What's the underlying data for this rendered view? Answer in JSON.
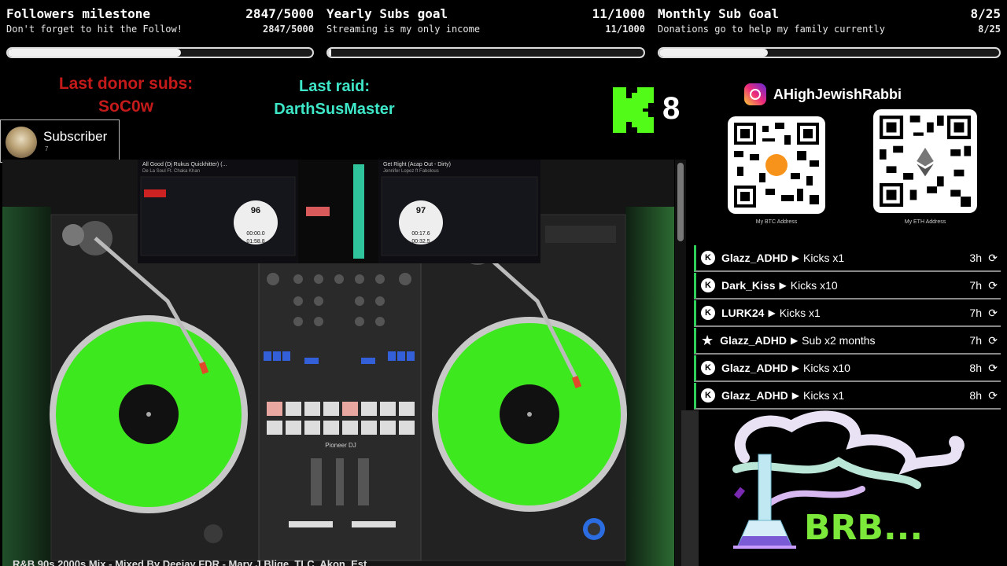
{
  "goals": [
    {
      "title": "Followers milestone",
      "count": "2847/5000",
      "subtitle": "Don't forget to hit the Follow!",
      "count2": "2847/5000",
      "progress": 0.569
    },
    {
      "title": "Yearly Subs goal",
      "count": "11/1000",
      "subtitle": "Streaming is my only income",
      "count2": "11/1000",
      "progress": 0.011
    },
    {
      "title": "Monthly Sub Goal",
      "count": "8/25",
      "subtitle": "Donations go to help my family currently",
      "count2": "8/25",
      "progress": 0.32
    }
  ],
  "donor": {
    "label": "Last donor subs:",
    "name": "SoC0w"
  },
  "raid": {
    "label": "Last raid:",
    "name": "DarthSusMaster"
  },
  "kick": {
    "count": "8",
    "logo_color": "#53fc18"
  },
  "subscriber": {
    "label": "Subscriber",
    "count": "7"
  },
  "instagram": {
    "handle": "AHighJewishRabbi",
    "icon": "instagram-icon"
  },
  "qr": {
    "btc_label": "My BTC Address",
    "eth_label": "My ETH Address"
  },
  "feed": [
    {
      "icon": "kick-icon",
      "user": "Glazz_ADHD",
      "action": "Kicks x1",
      "time": "3h"
    },
    {
      "icon": "kick-icon",
      "user": "Dark_Kiss",
      "action": "Kicks x10",
      "time": "7h"
    },
    {
      "icon": "kick-icon",
      "user": "LURK24",
      "action": "Kicks x1",
      "time": "7h"
    },
    {
      "icon": "star-icon",
      "user": "Glazz_ADHD",
      "action": "Sub x2 months",
      "time": "7h"
    },
    {
      "icon": "kick-icon",
      "user": "Glazz_ADHD",
      "action": "Kicks x10",
      "time": "8h"
    },
    {
      "icon": "kick-icon",
      "user": "Glazz_ADHD",
      "action": "Kicks x1",
      "time": "8h"
    }
  ],
  "video": {
    "caption": "R&B 90s 2000s Mix - Mixed By Deejay FDR - Mary J Blige, TLC, Akon, Est",
    "deck_left": {
      "track": "All Good (Dj Rukus Quickhitter) (...",
      "artist": "De La Soul Ft. Chaka Khan",
      "bpm": "96",
      "elapsed": "00:00.0",
      "remain": "01:58.8"
    },
    "deck_right": {
      "track": "Get Right (Acap Out - Dirty)",
      "artist": "Jennifer Lopez ft Fabolous",
      "bpm": "97",
      "elapsed": "00:17.6",
      "remain": "00:32.5"
    },
    "brand": "Pioneer DJ",
    "platter_color": "#3ee81f"
  },
  "brb": {
    "text": "BRB...",
    "color": "#7be83a"
  }
}
